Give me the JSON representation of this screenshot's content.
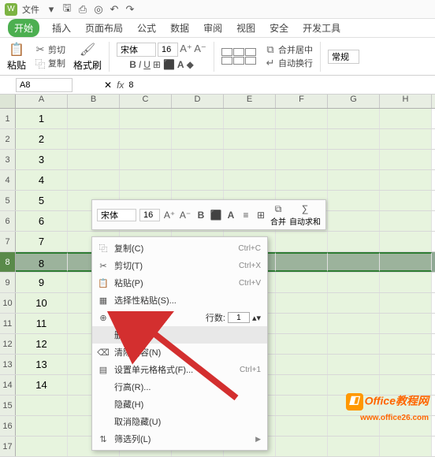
{
  "menubar": {
    "file_label": "文件"
  },
  "tabs": {
    "items": [
      "开始",
      "插入",
      "页面布局",
      "公式",
      "数据",
      "审阅",
      "视图",
      "安全",
      "开发工具"
    ],
    "active_index": 0
  },
  "ribbon": {
    "paste": "粘贴",
    "cut": "剪切",
    "copy": "复制",
    "format_painter": "格式刷",
    "font_name": "宋体",
    "font_size": "16",
    "merge_center": "合并居中",
    "wrap_text": "自动换行",
    "number_format": "常规"
  },
  "namebox": {
    "ref": "A8",
    "formula": "8"
  },
  "columns": [
    "A",
    "B",
    "C",
    "D",
    "E",
    "F",
    "G",
    "H"
  ],
  "rows_data": [
    "1",
    "2",
    "3",
    "4",
    "5",
    "6",
    "7",
    "8",
    "9",
    "10",
    "11",
    "12",
    "13",
    "14",
    "",
    "",
    ""
  ],
  "selected_row": 8,
  "mini_toolbar": {
    "font_name": "宋体",
    "font_size": "16",
    "merge": "合并",
    "autosum": "自动求和"
  },
  "context_menu": {
    "copy": "复制(C)",
    "cut": "剪切(T)",
    "paste": "粘贴(P)",
    "paste_special": "选择性粘贴(S)...",
    "insert": "插入(I)",
    "row_count_label": "行数:",
    "row_count_value": "1",
    "delete": "删除(D)",
    "clear": "清除内容(N)",
    "format_cells": "设置单元格格式(F)...",
    "row_height": "行高(R)...",
    "hide": "隐藏(H)",
    "unhide": "取消隐藏(U)",
    "filter": "筛选列(L)",
    "sc_copy": "Ctrl+C",
    "sc_cut": "Ctrl+X",
    "sc_paste": "Ctrl+V",
    "sc_format": "Ctrl+1"
  },
  "watermark": {
    "title": "Office教程网",
    "url": "www.office26.com"
  }
}
